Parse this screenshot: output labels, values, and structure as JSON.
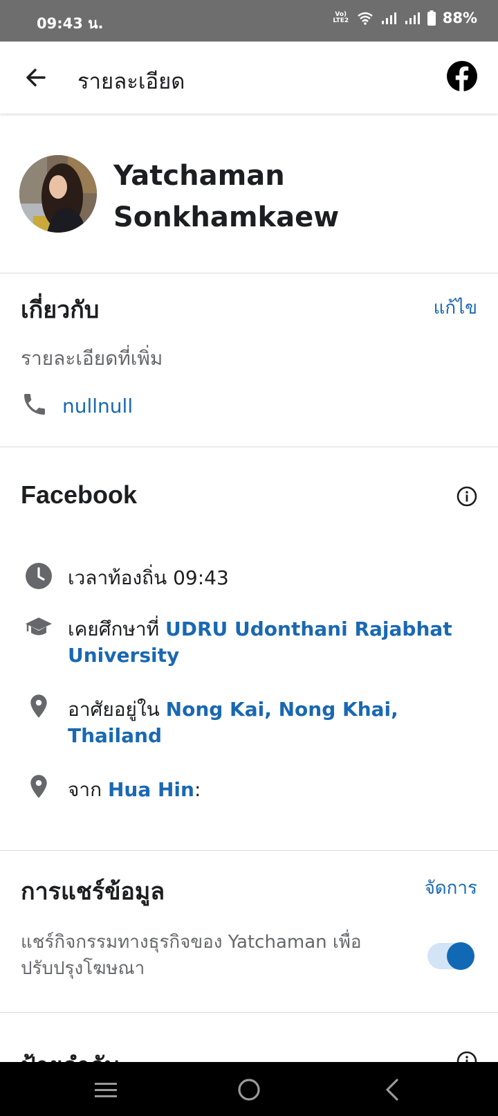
{
  "status": {
    "time": "09:43 น.",
    "network": "Vo) LTE2",
    "battery": "88%"
  },
  "appbar": {
    "title": "รายละเอียด"
  },
  "profile": {
    "name": "Yatchaman Sonkhamkaew"
  },
  "about": {
    "title": "เกี่ยวกับ",
    "edit_label": "แก้ไข",
    "subtitle": "รายละเอียดที่เพิ่ม",
    "phone": "nullnull"
  },
  "facebook": {
    "title": "Facebook",
    "local_time": "เวลาท้องถิ่น 09:43",
    "education_prefix": "เคยศึกษาที่ ",
    "education_link": "UDRU Udonthani Rajabhat University",
    "lives_prefix": "อาศัยอยู่ใน ",
    "lives_link": "Nong Kai, Nong Khai, Thailand",
    "from_prefix": "จาก ",
    "from_link": "Hua Hin",
    "from_suffix": ":"
  },
  "sharing": {
    "title": "การแชร์ข้อมูล",
    "manage_label": "จัดการ",
    "description": "แชร์กิจกรรมทางธุรกิจของ Yatchaman เพื่อปรับปรุงโฆษณา",
    "toggle_on": true
  },
  "next_section": {
    "title": "ป้ายกำกับ"
  },
  "colors": {
    "accent": "#1968b3",
    "toggle": "#1169b5"
  }
}
